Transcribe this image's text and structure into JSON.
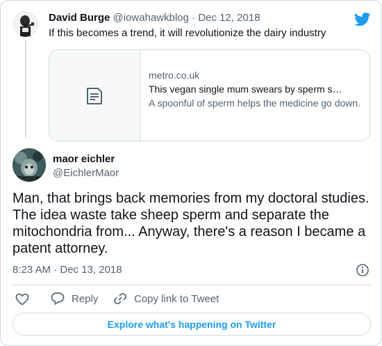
{
  "parent": {
    "author_name": "David Burge",
    "meta": "@iowahawkblog · Dec 12, 2018",
    "text": "If this becomes a trend, it will revolutionize the dairy industry",
    "avatar_icon": "bw-man-smoking-pipe-avatar"
  },
  "link_card": {
    "domain": "metro.co.uk",
    "title": "This vegan single mum swears by sperm s…",
    "description": "A spoonful of sperm helps the medicine go down.",
    "thumbnail_icon": "document-icon"
  },
  "reply": {
    "author_name": "maor eichler",
    "handle": "@EichlerMaor",
    "text": "Man, that brings back memories from my doctoral studies. The idea waste take sheep sperm and separate the mitochondria from... Anyway, there's a reason I became a patent attorney.",
    "timestamp": "8:23 AM · Dec 13, 2018"
  },
  "actions": {
    "reply_label": "Reply",
    "copy_label": "Copy link to Tweet"
  },
  "explore_label": "Explore what's happening on Twitter",
  "colors": {
    "accent": "#1d9bf0",
    "text": "#0f1419",
    "muted": "#536471",
    "border": "#cfd9de"
  }
}
